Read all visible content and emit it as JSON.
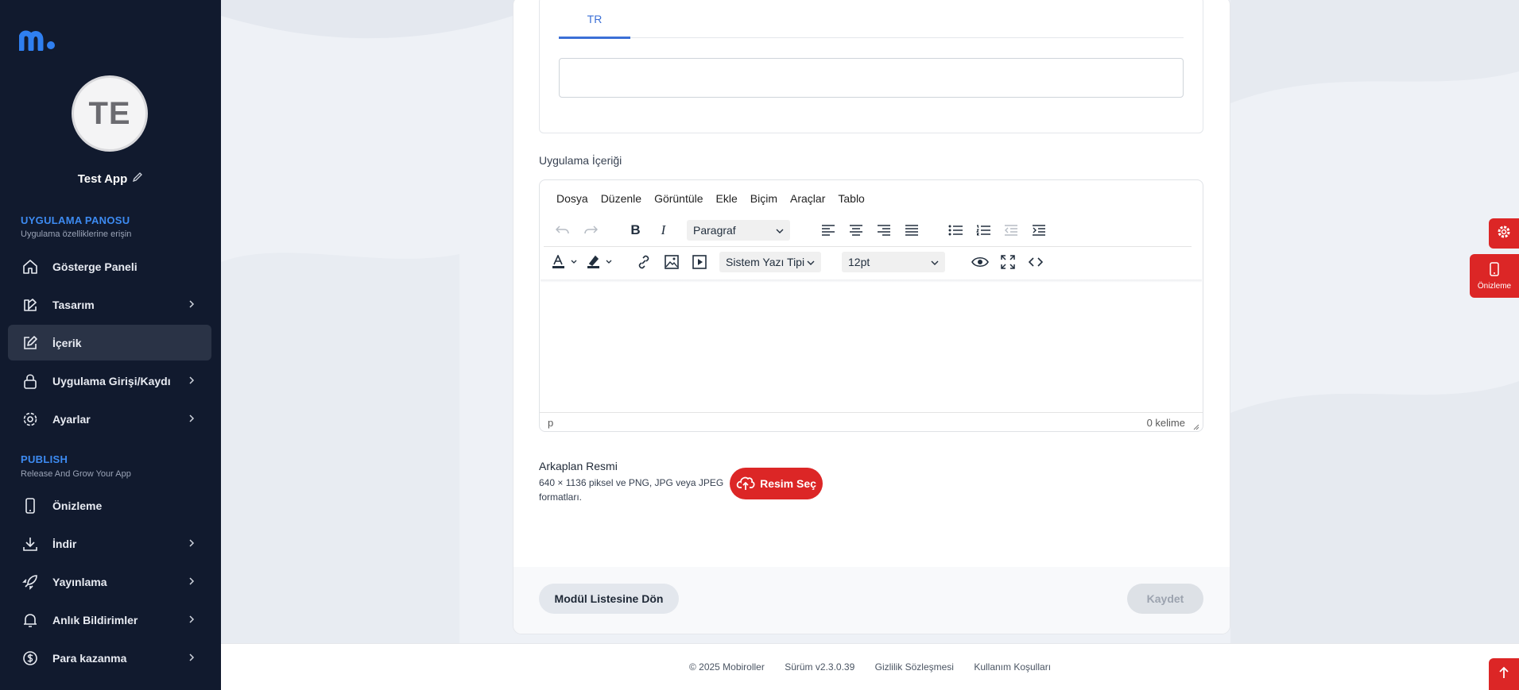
{
  "app": {
    "avatar_initials": "TE",
    "name": "Test App"
  },
  "sidebar": {
    "section1": {
      "title": "UYGULAMA PANOSU",
      "subtitle": "Uygulama özelliklerine erişin"
    },
    "section2": {
      "title": "PUBLISH",
      "subtitle": "Release And Grow Your App"
    },
    "items": [
      {
        "label": "Gösterge Paneli",
        "icon": "home-icon"
      },
      {
        "label": "Tasarım",
        "icon": "palette-icon"
      },
      {
        "label": "İçerik",
        "icon": "edit-icon"
      },
      {
        "label": "Uygulama Girişi/Kaydı",
        "icon": "lock-icon"
      },
      {
        "label": "Ayarlar",
        "icon": "gear-icon"
      },
      {
        "label": "Önizleme",
        "icon": "phone-icon"
      },
      {
        "label": "İndir",
        "icon": "download-icon"
      },
      {
        "label": "Yayınlama",
        "icon": "rocket-icon"
      },
      {
        "label": "Anlık Bildirimler",
        "icon": "bell-icon"
      },
      {
        "label": "Para kazanma",
        "icon": "dollar-icon"
      }
    ]
  },
  "lang_tabs": {
    "active": "TR"
  },
  "content": {
    "label": "Uygulama İçeriği",
    "menu": [
      "Dosya",
      "Düzenle",
      "Görüntüle",
      "Ekle",
      "Biçim",
      "Araçlar",
      "Tablo"
    ],
    "block_format": "Paragraf",
    "font_family": "Sistem Yazı Tipi",
    "font_size": "12pt",
    "status_path": "p",
    "word_count": "0 kelime"
  },
  "background": {
    "title": "Arkaplan Resmi",
    "description": "640 × 1136 piksel ve PNG, JPG veya JPEG formatları.",
    "select_label": "Resim Seç"
  },
  "actions": {
    "back_label": "Modül Listesine Dön",
    "save_label": "Kaydet"
  },
  "floating": {
    "preview_label": "Önizleme"
  },
  "footer": {
    "copyright": "© 2025 Mobiroller",
    "version": "Sürüm v2.3.0.39",
    "privacy": "Gizlilik Sözleşmesi",
    "terms": "Kullanım Koşulları"
  },
  "colors": {
    "sidebar_bg": "#111a2e",
    "accent_blue": "#3d8bf2",
    "accent_red": "#dc2626"
  }
}
